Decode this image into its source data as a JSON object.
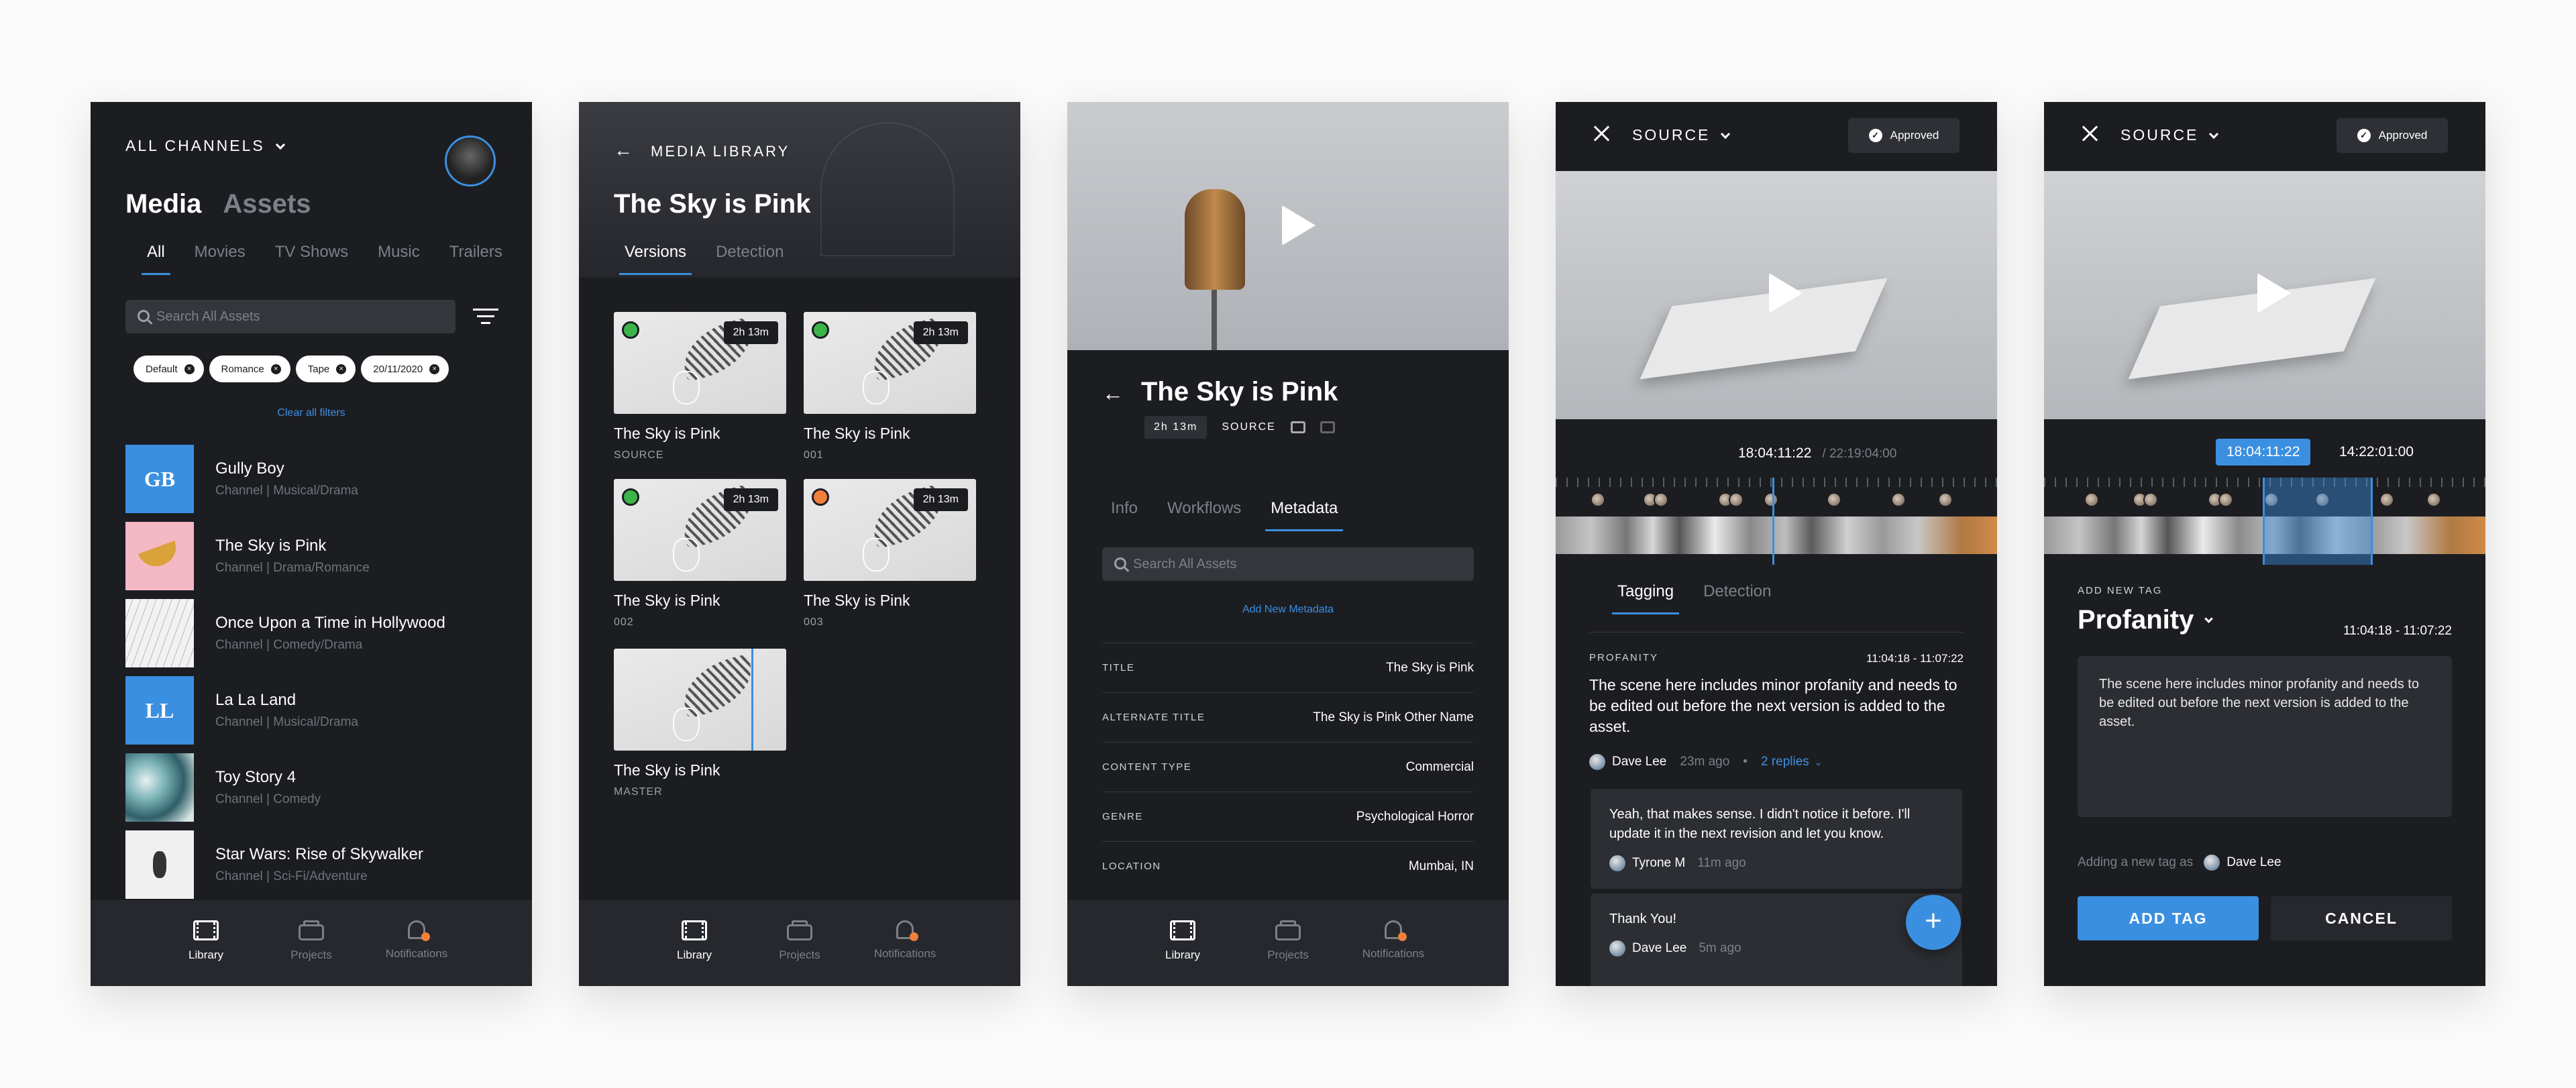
{
  "colors": {
    "accent": "#3b8fe0",
    "background": "#1c1d21",
    "navbar": "#26282d",
    "notification_dot": "#f0803c",
    "status_green": "#3bb54a",
    "status_orange": "#f0803c"
  },
  "nav": {
    "library": "Library",
    "projects": "Projects",
    "notifications": "Notifications",
    "icons": [
      "film-icon",
      "box-icon",
      "bell-icon"
    ]
  },
  "s1": {
    "channel": "ALL CHANNELS",
    "title_media": "Media",
    "title_assets": "Assets",
    "tabs": [
      "All",
      "Movies",
      "TV Shows",
      "Music",
      "Trailers"
    ],
    "search_placeholder": "Search All Assets",
    "chips": [
      "Default",
      "Romance",
      "Tape",
      "20/11/2020"
    ],
    "clear": "Clear all filters",
    "items": [
      {
        "title": "Gully Boy",
        "sub": "Channel | Musical/Drama",
        "thumb": "GB"
      },
      {
        "title": "The Sky is Pink",
        "sub": "Channel | Drama/Romance"
      },
      {
        "title": "Once Upon a Time in Hollywood",
        "sub": "Channel | Comedy/Drama"
      },
      {
        "title": "La La Land",
        "sub": "Channel | Musical/Drama",
        "thumb": "LL"
      },
      {
        "title": "Toy Story 4",
        "sub": "Channel | Comedy"
      },
      {
        "title": "Star Wars: Rise of Skywalker",
        "sub": "Channel | Sci-Fi/Adventure"
      }
    ]
  },
  "s2": {
    "back_label": "MEDIA LIBRARY",
    "title": "The Sky is Pink",
    "tabs": [
      "Versions",
      "Detection"
    ],
    "versions": [
      {
        "title": "The Sky is Pink",
        "sub": "SOURCE",
        "dur": "2h 13m",
        "status": "green"
      },
      {
        "title": "The Sky is Pink",
        "sub": "001",
        "dur": "2h 13m",
        "status": "green"
      },
      {
        "title": "The Sky is Pink",
        "sub": "002",
        "dur": "2h 13m",
        "status": "green"
      },
      {
        "title": "The Sky is Pink",
        "sub": "003",
        "dur": "2h 13m",
        "status": "orange"
      },
      {
        "title": "The Sky is Pink",
        "sub": "MASTER"
      }
    ]
  },
  "s3": {
    "title": "The Sky is Pink",
    "duration": "2h 13m",
    "source": "SOURCE",
    "tabs": [
      "Info",
      "Workflows",
      "Metadata"
    ],
    "search_placeholder": "Search All Assets",
    "add_metadata": "Add New Metadata",
    "rows": [
      {
        "k": "TITLE",
        "v": "The Sky is Pink"
      },
      {
        "k": "ALTERNATE TITLE",
        "v": "The Sky is Pink Other Name"
      },
      {
        "k": "CONTENT TYPE",
        "v": "Commercial"
      },
      {
        "k": "GENRE",
        "v": "Psychological Horror"
      },
      {
        "k": "LOCATION",
        "v": "Mumbai, IN"
      }
    ]
  },
  "s4": {
    "source": "SOURCE",
    "approved": "Approved",
    "time": "18:04:11:22",
    "total": "/ 22:19:04:00",
    "tabs": [
      "Tagging",
      "Detection"
    ],
    "tag": "PROFANITY",
    "range": "11:04:18 - 11:07:22",
    "body": "The scene here includes minor profanity and needs to be edited out before the next version is added to the asset.",
    "author": "Dave Lee",
    "ago": "23m ago",
    "replies": "2 replies",
    "reply1": {
      "text": "Yeah, that makes sense. I didn't notice it before. I'll update it in the next revision and let you know.",
      "author": "Tyrone M",
      "ago": "11m ago"
    },
    "reply2": {
      "text": "Thank You!",
      "author": "Dave Lee",
      "ago": "5m ago"
    },
    "fab": "+"
  },
  "s5": {
    "source": "SOURCE",
    "approved": "Approved",
    "time_start": "18:04:11:22",
    "time_end": "14:22:01:00",
    "add_new": "ADD NEW TAG",
    "tag": "Profanity",
    "range": "11:04:18 - 11:07:22",
    "body": "The scene here includes minor profanity and needs to be edited out before the next version is added to the asset.",
    "adding": "Adding a new tag as",
    "author": "Dave Lee",
    "add_btn": "ADD TAG",
    "cancel_btn": "CANCEL"
  }
}
